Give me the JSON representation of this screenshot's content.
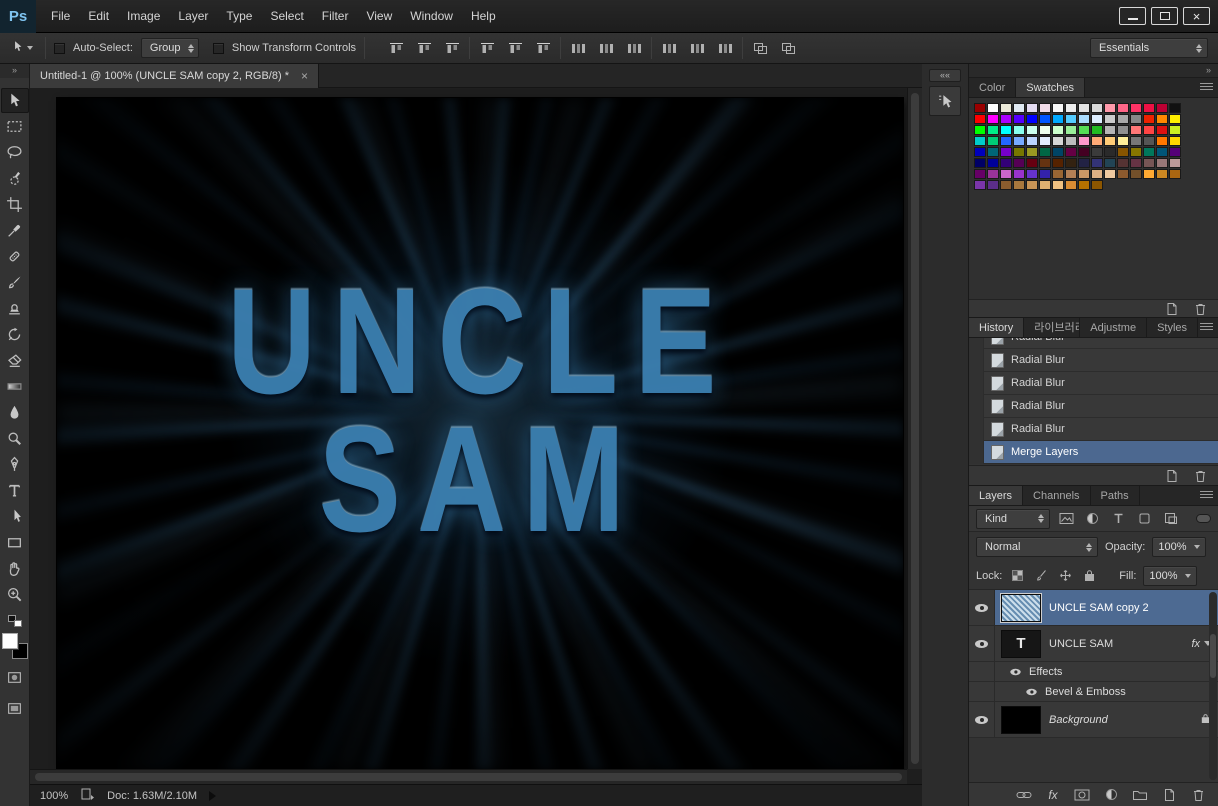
{
  "window": {
    "logo": "Ps",
    "title_tab": "Untitled-1 @ 100% (UNCLE SAM copy 2, RGB/8) *",
    "controls": [
      "minimize-button",
      "maximize-button",
      "close-button"
    ]
  },
  "menubar": {
    "items": [
      "File",
      "Edit",
      "Image",
      "Layer",
      "Type",
      "Select",
      "Filter",
      "View",
      "Window",
      "Help"
    ]
  },
  "options_bar": {
    "tool_preset": "move-tool",
    "auto_select_label": "Auto-Select:",
    "auto_select_value": "Group",
    "auto_select_checked": false,
    "show_transform_label": "Show Transform Controls",
    "show_transform_checked": false,
    "align_icons": [
      "align-top-edges",
      "align-vertical-centers",
      "align-bottom-edges",
      "align-left-edges",
      "align-horizontal-centers",
      "align-right-edges",
      "distribute-top-edges",
      "distribute-vertical-centers",
      "distribute-bottom-edges",
      "distribute-left-edges",
      "distribute-horizontal-centers",
      "distribute-right-edges",
      "auto-align-layers",
      "3d-mode"
    ],
    "workspace": "Essentials"
  },
  "selected_tool": "move-tool",
  "tools_order": [
    "move-tool",
    "rectangular-marquee-tool",
    "lasso-tool",
    "quick-selection-tool",
    "crop-tool",
    "eyedropper-tool",
    "spot-healing-brush-tool",
    "brush-tool",
    "clone-stamp-tool",
    "history-brush-tool",
    "eraser-tool",
    "gradient-tool",
    "blur-tool",
    "dodge-tool",
    "pen-tool",
    "type-tool",
    "path-selection-tool",
    "rectangle-tool",
    "hand-tool",
    "zoom-tool"
  ],
  "tool_widgets": [
    "default-colors-icon",
    "foreground-background-swatch",
    "quick-mask-icon",
    "screen-mode-icon"
  ],
  "canvas": {
    "line1": "UNCLE",
    "line2": "SAM",
    "text_color": "#3b7fb0",
    "background": "#000000",
    "ray_color": "#55a8e0"
  },
  "status_bar": {
    "zoom": "100%",
    "doc_info": "Doc: 1.63M/2.10M"
  },
  "collapsed_dock": [
    "collapse-dock-button",
    "collapsed-panel-icon"
  ],
  "panels": {
    "color_swatches": {
      "tabs": [
        "Color",
        "Swatches"
      ],
      "active_tab": "Swatches",
      "footer_icons": [
        "new-swatch-icon",
        "delete-swatch-icon"
      ],
      "swatches": [
        "#990000",
        "#ffffff",
        "#ebe9d8",
        "#dfe9f2",
        "#e4dcf2",
        "#f2dce9",
        "#f7f7f7",
        "#ededed",
        "#e3e3e3",
        "#d9d9d9",
        "#ff99aa",
        "#ff6688",
        "#ff3366",
        "#ee1144",
        "#bb0033",
        "#111111",
        "#ff0000",
        "#ff00ff",
        "#aa00ff",
        "#5500ff",
        "#0000ff",
        "#0055ff",
        "#00aaff",
        "#55ccff",
        "#aaddff",
        "#ddeeff",
        "#cccccc",
        "#aaaaaa",
        "#888888",
        "#ee2200",
        "#ff8800",
        "#ffee00",
        "#00ff00",
        "#00ee88",
        "#00ffff",
        "#88ffee",
        "#ccffee",
        "#eeffee",
        "#ccffcc",
        "#99ee99",
        "#55dd55",
        "#22bb22",
        "#b5b5b5",
        "#909090",
        "#ff7777",
        "#ff4444",
        "#dd1111",
        "#ccee22",
        "#00cccc",
        "#00cc77",
        "#2266ff",
        "#77aaff",
        "#bbd4ff",
        "#e2eeff",
        "#d6d6d6",
        "#bdbdbd",
        "#ff99cc",
        "#ffaa77",
        "#ffcc77",
        "#ffee99",
        "#777777",
        "#555555",
        "#ff7700",
        "#ffd700",
        "#0000bb",
        "#006677",
        "#7700cc",
        "#777700",
        "#999922",
        "#006644",
        "#004466",
        "#660044",
        "#440022",
        "#3b3b3b",
        "#2a2a2a",
        "#885500",
        "#887700",
        "#00775b",
        "#005577",
        "#550077",
        "#000066",
        "#000099",
        "#330077",
        "#550055",
        "#660011",
        "#663311",
        "#552200",
        "#332211",
        "#222244",
        "#333377",
        "#224455",
        "#553333",
        "#663344",
        "#775555",
        "#997777",
        "#bb9999",
        "#660066",
        "#993399",
        "#cc66cc",
        "#9933cc",
        "#6633cc",
        "#3322aa",
        "#996633",
        "#b38055",
        "#cc9966",
        "#dfb184",
        "#efc9a0",
        "#8c5a2e",
        "#73502a",
        "#ffaa33",
        "#cc8822",
        "#aa6611",
        "#7a35a8",
        "#5c2e8a",
        "#8a5c2e",
        "#a8783d",
        "#c79456",
        "#dfb070",
        "#efc080",
        "#d98c33",
        "#b37000",
        "#8c5600"
      ]
    },
    "history": {
      "tabs": [
        "History",
        "라이브러리",
        "Adjustme",
        "Styles"
      ],
      "active_tab": "History",
      "items": [
        {
          "label": "Radial Blur",
          "partial": true
        },
        {
          "label": "Radial Blur"
        },
        {
          "label": "Radial Blur"
        },
        {
          "label": "Radial Blur"
        },
        {
          "label": "Radial Blur"
        },
        {
          "label": "Merge Layers",
          "selected": true
        }
      ],
      "footer_icons": [
        "new-document-from-state-icon",
        "delete-state-icon"
      ]
    },
    "layers": {
      "tabs": [
        "Layers",
        "Channels",
        "Paths"
      ],
      "active_tab": "Layers",
      "kind_label": "Kind",
      "filter_icons": [
        "pixel-layer-filter-icon",
        "adjustment-layer-filter-icon",
        "type-layer-filter-icon",
        "shape-layer-filter-icon",
        "smart-object-filter-icon",
        "layer-filter-toggle"
      ],
      "blend_mode": "Normal",
      "opacity_label": "Opacity:",
      "opacity_value": "100%",
      "lock_label": "Lock:",
      "lock_icons": [
        "lock-transparent-pixels-icon",
        "lock-image-pixels-icon",
        "lock-position-icon",
        "lock-all-icon"
      ],
      "fill_label": "Fill:",
      "fill_value": "100%",
      "rows": [
        {
          "name": "UNCLE SAM copy 2",
          "selected": true
        },
        {
          "name": "UNCLE SAM",
          "thumb_glyph": "T",
          "fx_label": "fx"
        },
        {
          "name": "Effects"
        },
        {
          "name": "Bevel & Emboss"
        },
        {
          "name": "Background",
          "locked": true
        }
      ],
      "footer_icons": [
        "link-layers-icon",
        "layer-style-icon",
        "add-layer-mask-icon",
        "new-adjustment-layer-icon",
        "new-group-icon",
        "new-layer-icon",
        "delete-layer-icon"
      ]
    }
  }
}
